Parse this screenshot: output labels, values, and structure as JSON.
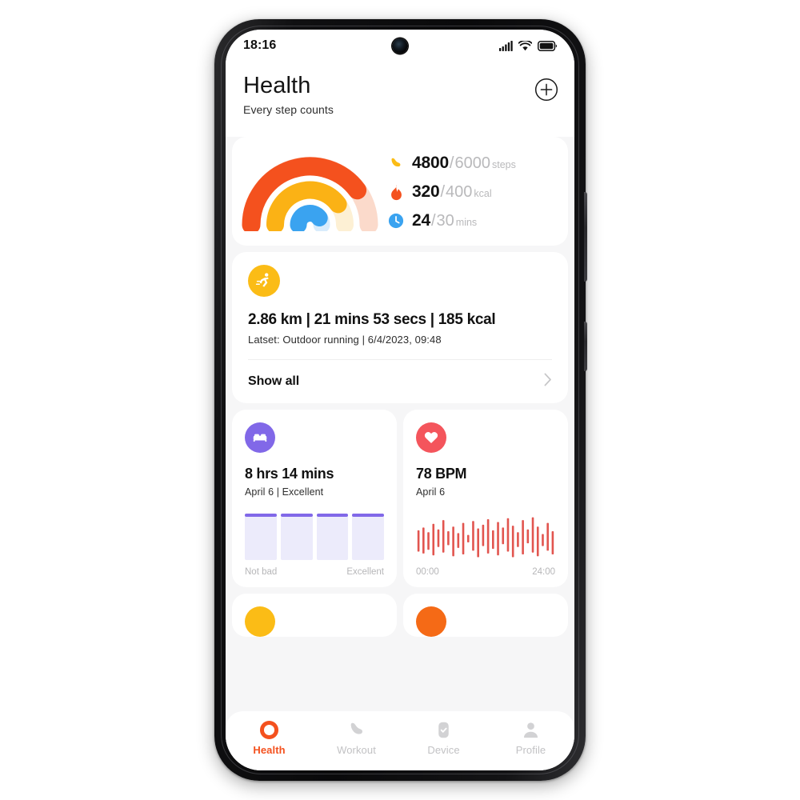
{
  "status_bar": {
    "time": "18:16",
    "icons": [
      "signal-icon",
      "wifi-icon",
      "battery-icon"
    ]
  },
  "header": {
    "title": "Health",
    "subtitle": "Every step counts",
    "add_button": "add-icon"
  },
  "summary_card": {
    "gauge": {
      "arcs": [
        {
          "name": "steps",
          "color": "#f4511e",
          "track": "#fbdacb",
          "progress": 0.8
        },
        {
          "name": "calories",
          "color": "#fbb215",
          "track": "#fdf0d4",
          "progress": 0.8
        },
        {
          "name": "activity",
          "color": "#3aa3f0",
          "track": "#d8ecfc",
          "progress": 0.8
        }
      ]
    },
    "metrics": [
      {
        "icon": "shoe-icon",
        "icon_color": "#fbbc16",
        "current": "4800",
        "separator": "/",
        "goal": "6000",
        "unit": "steps"
      },
      {
        "icon": "flame-icon",
        "icon_color": "#f4511e",
        "current": "320",
        "separator": "/",
        "goal": "400",
        "unit": "kcal"
      },
      {
        "icon": "clock-icon",
        "icon_color": "#3aa3f0",
        "current": "24",
        "separator": "/",
        "goal": "30",
        "unit": "mins"
      }
    ]
  },
  "workout_card": {
    "icon": "running-icon",
    "summary": "2.86 km | 21 mins 53 secs | 185 kcal",
    "details": "Latset:  Outdoor running | 6/4/2023, 09:48",
    "show_all_label": "Show all",
    "chevron": "chevron-right-icon"
  },
  "sleep_card": {
    "icon": "bed-icon",
    "value": "8 hrs 14 mins",
    "subtitle": "April 6 | Excellent",
    "legend_left": "Not bad",
    "legend_right": "Excellent",
    "bars": [
      1,
      1,
      1,
      1
    ]
  },
  "heart_card": {
    "icon": "heart-icon",
    "value": "78 BPM",
    "subtitle": "April 6",
    "legend_left": "00:00",
    "legend_right": "24:00",
    "bar_color": "#e2554f",
    "bars": [
      {
        "top": 0.36,
        "bottom": 0.82
      },
      {
        "top": 0.3,
        "bottom": 0.86
      },
      {
        "top": 0.4,
        "bottom": 0.78
      },
      {
        "top": 0.22,
        "bottom": 0.9
      },
      {
        "top": 0.34,
        "bottom": 0.72
      },
      {
        "top": 0.14,
        "bottom": 0.84
      },
      {
        "top": 0.38,
        "bottom": 0.68
      },
      {
        "top": 0.28,
        "bottom": 0.92
      },
      {
        "top": 0.42,
        "bottom": 0.74
      },
      {
        "top": 0.2,
        "bottom": 0.88
      },
      {
        "top": 0.46,
        "bottom": 0.62
      },
      {
        "top": 0.16,
        "bottom": 0.8
      },
      {
        "top": 0.32,
        "bottom": 0.94
      },
      {
        "top": 0.24,
        "bottom": 0.7
      },
      {
        "top": 0.12,
        "bottom": 0.86
      },
      {
        "top": 0.36,
        "bottom": 0.76
      },
      {
        "top": 0.18,
        "bottom": 0.9
      },
      {
        "top": 0.3,
        "bottom": 0.66
      },
      {
        "top": 0.1,
        "bottom": 0.82
      },
      {
        "top": 0.26,
        "bottom": 0.94
      },
      {
        "top": 0.4,
        "bottom": 0.72
      },
      {
        "top": 0.14,
        "bottom": 0.88
      },
      {
        "top": 0.34,
        "bottom": 0.64
      },
      {
        "top": 0.08,
        "bottom": 0.84
      },
      {
        "top": 0.28,
        "bottom": 0.92
      },
      {
        "top": 0.44,
        "bottom": 0.7
      },
      {
        "top": 0.2,
        "bottom": 0.8
      },
      {
        "top": 0.38,
        "bottom": 0.88
      }
    ]
  },
  "peek_cards": [
    {
      "icon": "peek-icon-yellow",
      "color": "#fbbc16"
    },
    {
      "icon": "peek-icon-orange",
      "color": "#f56a16"
    }
  ],
  "bottom_nav": {
    "active_color": "#f4511e",
    "items": [
      {
        "label": "Health",
        "icon": "health-ring-icon",
        "active": true
      },
      {
        "label": "Workout",
        "icon": "shoe-icon",
        "active": false
      },
      {
        "label": "Device",
        "icon": "watch-check-icon",
        "active": false
      },
      {
        "label": "Profile",
        "icon": "person-icon",
        "active": false
      }
    ]
  }
}
